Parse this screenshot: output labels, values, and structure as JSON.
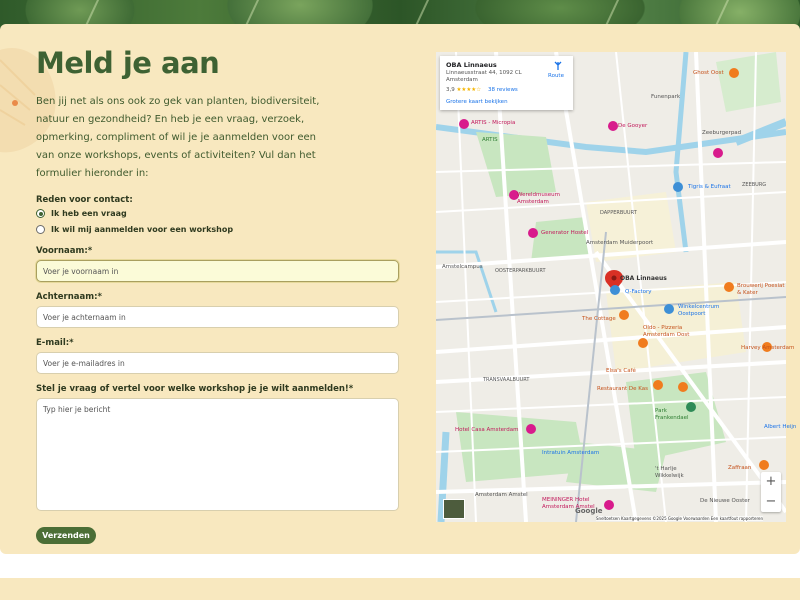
{
  "form": {
    "title": "Meld je aan",
    "intro": "Ben jij net als ons ook zo gek van planten, biodiversiteit, natuur en gezondheid? En heb je een vraag, verzoek, opmerking, compliment of wil je je aanmelden voor een van onze workshops, events of activiteiten? Vul dan het formulier hieronder in:",
    "reason_label": "Reden voor contact:",
    "reason_options": [
      "Ik heb een vraag",
      "Ik wil mij aanmelden voor een workshop"
    ],
    "reason_selected": "Ik heb een vraag",
    "first_name_label": "Voornaam:*",
    "first_name_placeholder": "Voer je voornaam in",
    "last_name_label": "Achternaam:*",
    "last_name_placeholder": "Voer je achternaam in",
    "email_label": "E-mail:*",
    "email_placeholder": "Voer je e-mailadres in",
    "message_label": "Stel je vraag of vertel voor welke workshop je je wilt aanmelden!*",
    "message_placeholder": "Typ hier je bericht",
    "submit_label": "Verzenden"
  },
  "map": {
    "place_name": "OBA Linnaeus",
    "place_address": "Linnaeusstraat 44, 1092 CL Amsterdam",
    "rating": "3,9",
    "stars": "★★★★☆",
    "reviews": "38 reviews",
    "larger_map_link": "Grotere kaart bekijken",
    "route_label": "Route",
    "zoom_in": "+",
    "zoom_out": "−",
    "google": "Google",
    "attribution": "Sneltoetsen   Kaartgegevens ©2025 Google   Voorwaarden   Een kaartfout rapporteren",
    "labels": {
      "oba": "OBA Linnaeus",
      "artis_micropia": "ARTIS - Micropia",
      "artis": "ARTIS",
      "de_gooyer": "De Gooyer",
      "wereldmuseum": "Wereldmuseum Amsterdam",
      "generator_hostel": "Generator Hostel",
      "q_factory": "Q-Factory",
      "winkelcentrum": "Winkelcentrum Oostpoort",
      "the_cottage": "The Cottage",
      "oldo_pizza": "Oldo - Pizzeria Amsterdam Oost",
      "elsas_cafe": "Elsa's Café",
      "restaurant_de_kas": "Restaurant De Kas",
      "hotel_casa": "Hotel Casa Amsterdam",
      "intratuin": "Intratuin Amsterdam",
      "meininger": "MEININGER Hotel Amsterdam Amstel",
      "tigris": "Tigris & Eufraat",
      "brouwerij": "Brouwerij Poesiat & Kater",
      "harvey": "Harvey Amsterdam",
      "zaffraan": "Zaffraan",
      "albert": "Albert Heijn",
      "ghost_oost": "Ghost Oost",
      "amsterdam_muiderpoort": "Amsterdam Muiderpoort",
      "oosterparkbuurt": "OOSTERPARKBUURT",
      "dapperbuurt": "DAPPERBUURT",
      "transvaalbuurt": "TRANSVAALBUURT",
      "zeeburg": "ZEEBURG",
      "amstelcampus": "Amstelcampus",
      "park_frankendael": "Park Frankendael",
      "amsterdam_amstel": "Amsterdam Amstel",
      "de_nieuwe_ooster": "De Nieuwe Ooster",
      "1_harlje": "'t Harlje Wikkelwijk",
      "funenpark": "Funenpark",
      "zeeburgerpad": "Zeeburgerpad"
    }
  }
}
